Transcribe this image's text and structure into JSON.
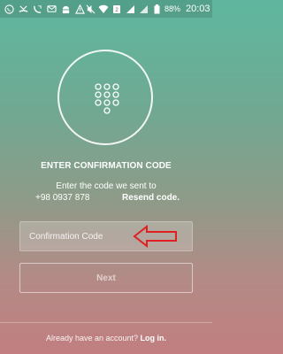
{
  "status_bar": {
    "left_icons": [
      "whatsapp-icon",
      "missed-call-icon",
      "call-forward-icon",
      "sms-icon",
      "android-icon",
      "alert-icon"
    ],
    "right_icons": [
      "mute-icon",
      "wifi-icon",
      "sim2-icon",
      "signal-icon",
      "signal-icon"
    ],
    "battery": "88%",
    "time": "20:03"
  },
  "main": {
    "title": "ENTER CONFIRMATION CODE",
    "subtitle": "Enter the code we sent to",
    "phone_number": "+98 0937 878",
    "resend_label": "Resend code.",
    "code_placeholder": "Confirmation Code",
    "code_value": "",
    "next_label": "Next"
  },
  "footer": {
    "prefix": "Already have an account?",
    "login_label": "Log in."
  },
  "colors": {
    "gradient_top": "#5fb79e",
    "gradient_bottom": "#c27e80",
    "annotation_arrow": "#e02020"
  }
}
